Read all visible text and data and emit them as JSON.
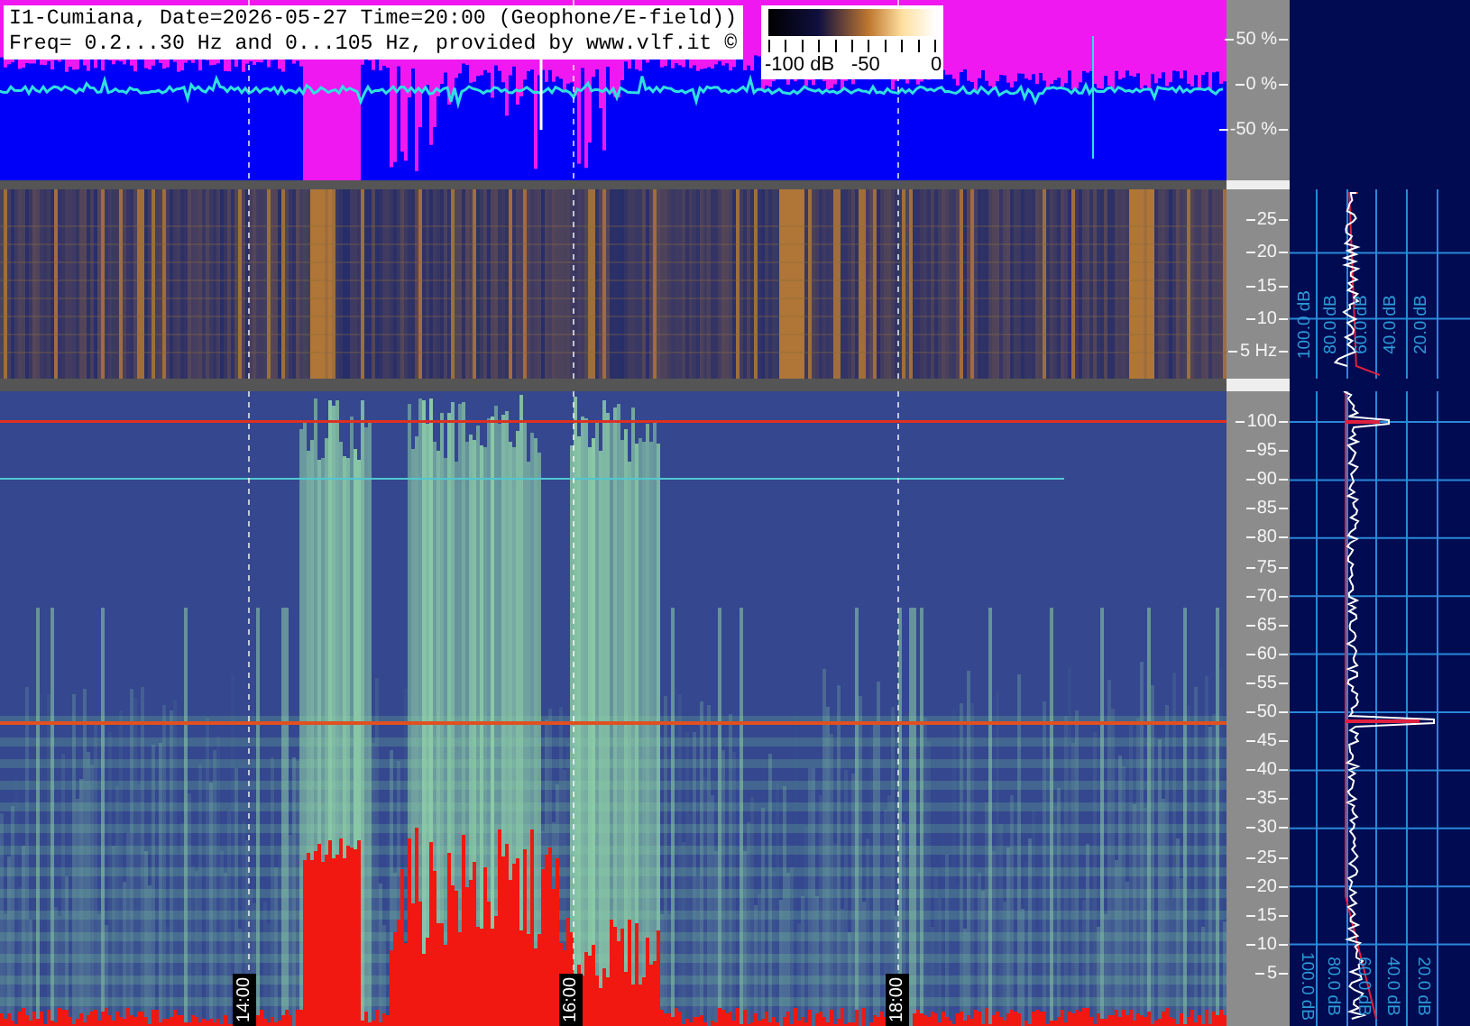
{
  "header": {
    "title": "I1-Cumiana, Date=2026-05-27 Time=20:00 (Geophone/E-field))",
    "subtitle": "Freq= 0.2...30 Hz and 0...105 Hz, provided by www.vlf.it ©"
  },
  "colorbar": {
    "labels": [
      "-100 dB",
      "-50",
      "0"
    ]
  },
  "waveform_axis": [
    "50 %",
    "0 %",
    "-50 %"
  ],
  "low_band_axis": [
    "25",
    "20",
    "15",
    "10",
    "5 Hz"
  ],
  "high_band_axis": [
    "100",
    "95",
    "90",
    "85",
    "80",
    "75",
    "70",
    "65",
    "60",
    "55",
    "50",
    "45",
    "40",
    "35",
    "30",
    "25",
    "20",
    "15",
    "10",
    "5"
  ],
  "time_labels": [
    "14:00",
    "16:00",
    "18:00"
  ],
  "low_spectrum_labels": [
    "100.0 dB",
    "80.0 dB",
    "60.0 dB",
    "40.0 dB",
    "20.0 dB"
  ],
  "high_spectrum_labels": [
    "100.0 dB",
    "80.0 dB",
    "60.0 dB",
    "40.0 dB",
    "20.0 dB"
  ]
}
